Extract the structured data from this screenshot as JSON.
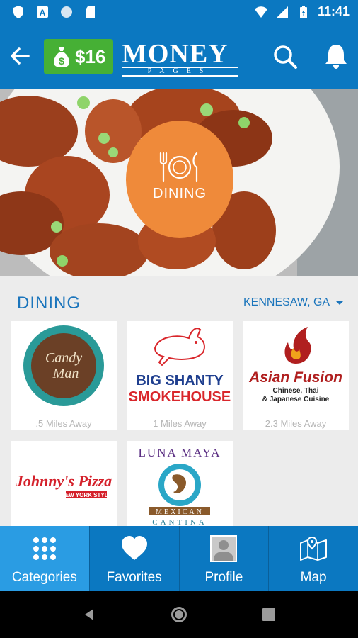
{
  "status_bar": {
    "time": "11:41"
  },
  "app_bar": {
    "balance": "$16",
    "logo_main": "MONEY",
    "logo_sub": "PAGES"
  },
  "hero": {
    "category_label": "DINING"
  },
  "section": {
    "title": "DINING",
    "location": "KENNESAW, GA"
  },
  "listings": [
    {
      "name": "Candy Man",
      "distance": ".5 Miles Away"
    },
    {
      "name": "Big Shanty Smokehouse",
      "name_line1": "BIG SHANTY",
      "name_line2": "SMOKEHOUSE",
      "distance": "1 Miles Away"
    },
    {
      "name": "Asian Fusion",
      "subtitle_line1": "Chinese, Thai",
      "subtitle_line2": "& Japanese Cuisine",
      "distance": "2.3 Miles Away"
    },
    {
      "name": "Johnny's Pizza",
      "subtitle": "NEW YORK STYLE"
    },
    {
      "name": "LUNA MAYA",
      "subtitle": "MEXICAN",
      "subtitle2": "CANTINA"
    }
  ],
  "tabs": [
    {
      "label": "Categories",
      "icon": "grid-icon",
      "active": true
    },
    {
      "label": "Favorites",
      "icon": "heart-icon"
    },
    {
      "label": "Profile",
      "icon": "person-icon"
    },
    {
      "label": "Map",
      "icon": "map-icon"
    }
  ],
  "colors": {
    "primary": "#0b78c1",
    "accent": "#ef8a3a",
    "wallet": "#46b035",
    "active_tab": "#2a9ce3"
  }
}
